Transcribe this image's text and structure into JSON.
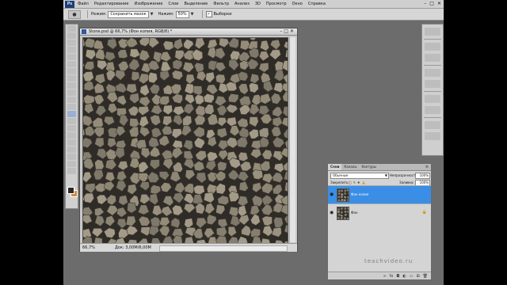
{
  "app": {
    "logo_text": "Ps",
    "menu": [
      "Файл",
      "Редактирование",
      "Изображение",
      "Слои",
      "Выделение",
      "Фильтр",
      "Анализ",
      "3D",
      "Просмотр",
      "Окно",
      "Справка"
    ],
    "window_controls": [
      "–",
      "□",
      "✕"
    ]
  },
  "options": {
    "mode_label": "Режим:",
    "mode_value": "Сохранить мазок",
    "opacity_label": "Нажим:",
    "opacity_value": "50%",
    "option_check_label": "Выборки"
  },
  "document": {
    "title": "Stone.psd @ 66,7% (Фон копия, RGB/8) *",
    "zoom": "66,7%",
    "doc_size": "Док: 3,00M/6,00M",
    "texture_colors": [
      "#8e8674",
      "#9a9180",
      "#7e786a",
      "#a39a88",
      "#867f70",
      "#948b79"
    ],
    "mortar_color": "#2f2c27"
  },
  "layers_panel": {
    "tabs": [
      "Слои",
      "Каналы",
      "Контуры"
    ],
    "blend_mode": "Обычные",
    "opacity_label": "Непрозрачность:",
    "opacity_value": "100%",
    "lock_label": "Закрепить:",
    "fill_label": "Заливка:",
    "fill_value": "100%",
    "layers": [
      {
        "name": "Фон копия",
        "selected": true
      },
      {
        "name": "Фон",
        "selected": false,
        "locked": true
      }
    ],
    "selected_color": "#3a8ee6"
  },
  "watermark": "teachvideo.ru"
}
